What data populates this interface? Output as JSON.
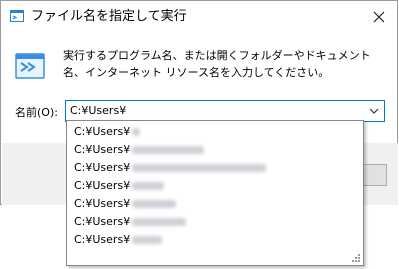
{
  "window": {
    "title": "ファイル名を指定して実行",
    "close_icon": "close-icon"
  },
  "description": "実行するプログラム名、または開くフォルダーやドキュメント名、インターネット リソース名を入力してください。",
  "name_field": {
    "label": "名前(O):",
    "value": "C:¥Users¥"
  },
  "dropdown": {
    "items": [
      {
        "prefix": "C:¥Users¥"
      },
      {
        "prefix": "C:¥Users¥"
      },
      {
        "prefix": "C:¥Users¥"
      },
      {
        "prefix": "C:¥Users¥"
      },
      {
        "prefix": "C:¥Users¥"
      },
      {
        "prefix": "C:¥Users¥"
      },
      {
        "prefix": "C:¥Users¥"
      }
    ]
  },
  "colors": {
    "accent": "#0078d7",
    "footer_bg": "#f0f0f0"
  }
}
